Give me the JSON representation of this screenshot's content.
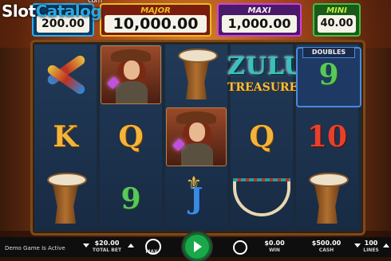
{
  "watermark": {
    "prefix": "Slot",
    "suffix": "Catalog",
    "com": "com"
  },
  "jackpots": {
    "grand": {
      "label": "",
      "value": "200.00"
    },
    "major": {
      "label": "MAJOR",
      "value": "10,000.00"
    },
    "maxi": {
      "label": "MAXI",
      "value": "1,000.00"
    },
    "mini": {
      "label": "MINI",
      "value": "40.00"
    }
  },
  "logo": {
    "line1": "ZULU",
    "line2": "TREASURE"
  },
  "doubles_badge": "DOUBLES",
  "reels": {
    "r1": [
      "bird-icon",
      "K",
      "drum-icon"
    ],
    "r2": [
      "woman-icon",
      "Q",
      "9"
    ],
    "r3": [
      "drum-icon",
      "woman-icon",
      "J"
    ],
    "r4": [
      "logo",
      "Q",
      "necklace-icon"
    ],
    "r5": [
      "9",
      "10",
      "drum-icon"
    ]
  },
  "symbols": {
    "k": "K",
    "q": "Q",
    "nine": "9",
    "j": "J",
    "ten": "10"
  },
  "controls": {
    "demo_text": "Demo Game Is Active",
    "total_bet_value": "$20.00",
    "total_bet_label": "TOTAL BET",
    "max_label": "MAX",
    "win_value": "$0.00",
    "win_label": "WIN",
    "cash_value": "$500.00",
    "cash_label": "CASH",
    "lines_value": "100",
    "lines_label": "LINES"
  },
  "colors": {
    "spin": "#1aa84a",
    "major": "#e8c020",
    "maxi": "#d040e0",
    "mini": "#40c040",
    "grand": "#2ab0e8"
  }
}
